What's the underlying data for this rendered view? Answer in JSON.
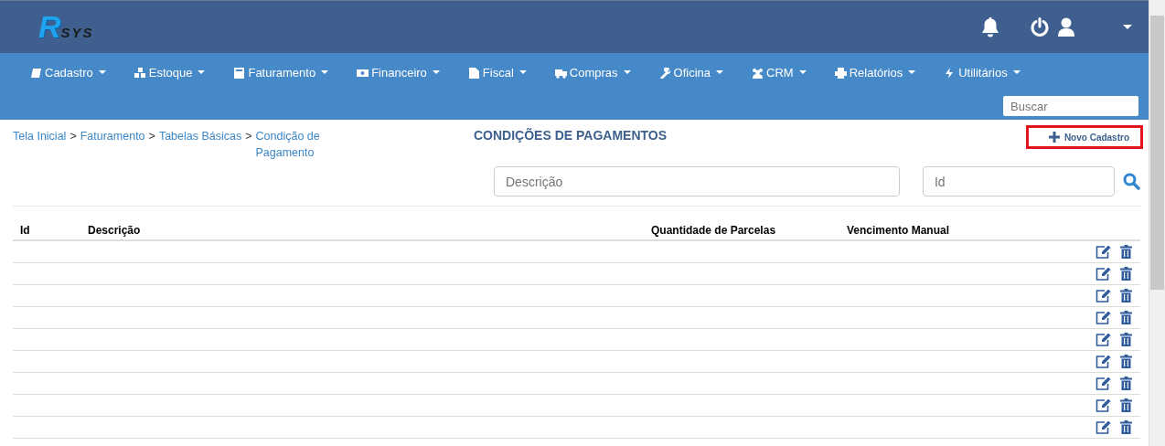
{
  "logo": {
    "letter": "R",
    "text": "SYS"
  },
  "menu": [
    {
      "label": "Cadastro"
    },
    {
      "label": "Estoque"
    },
    {
      "label": "Faturamento"
    },
    {
      "label": "Financeiro"
    },
    {
      "label": "Fiscal"
    },
    {
      "label": "Compras"
    },
    {
      "label": "Oficina"
    },
    {
      "label": "CRM"
    },
    {
      "label": "Relatórios"
    },
    {
      "label": "Utilitários"
    }
  ],
  "search": {
    "placeholder": "Buscar"
  },
  "breadcrumb": {
    "separator": ">",
    "items": [
      "Tela Inicial",
      "Faturamento",
      "Tabelas Básicas",
      "Condição de Pagamento"
    ]
  },
  "page_title": "CONDIÇÕES DE PAGAMENTOS",
  "new_button": {
    "label": "Novo Cadastro",
    "highlighted": true
  },
  "filters": [
    {
      "placeholder": "Descrição"
    },
    {
      "placeholder": "Id"
    }
  ],
  "table": {
    "columns": [
      "Id",
      "Descrição",
      "Quantidade de Parcelas",
      "Vencimento Manual"
    ],
    "rows": [
      {
        "kind": "empty"
      },
      {
        "kind": "empty"
      },
      {
        "kind": "empty"
      },
      {
        "kind": "empty"
      },
      {
        "kind": "empty"
      },
      {
        "kind": "empty"
      },
      {
        "kind": "empty"
      },
      {
        "kind": "empty"
      },
      {
        "kind": "empty"
      }
    ]
  }
}
